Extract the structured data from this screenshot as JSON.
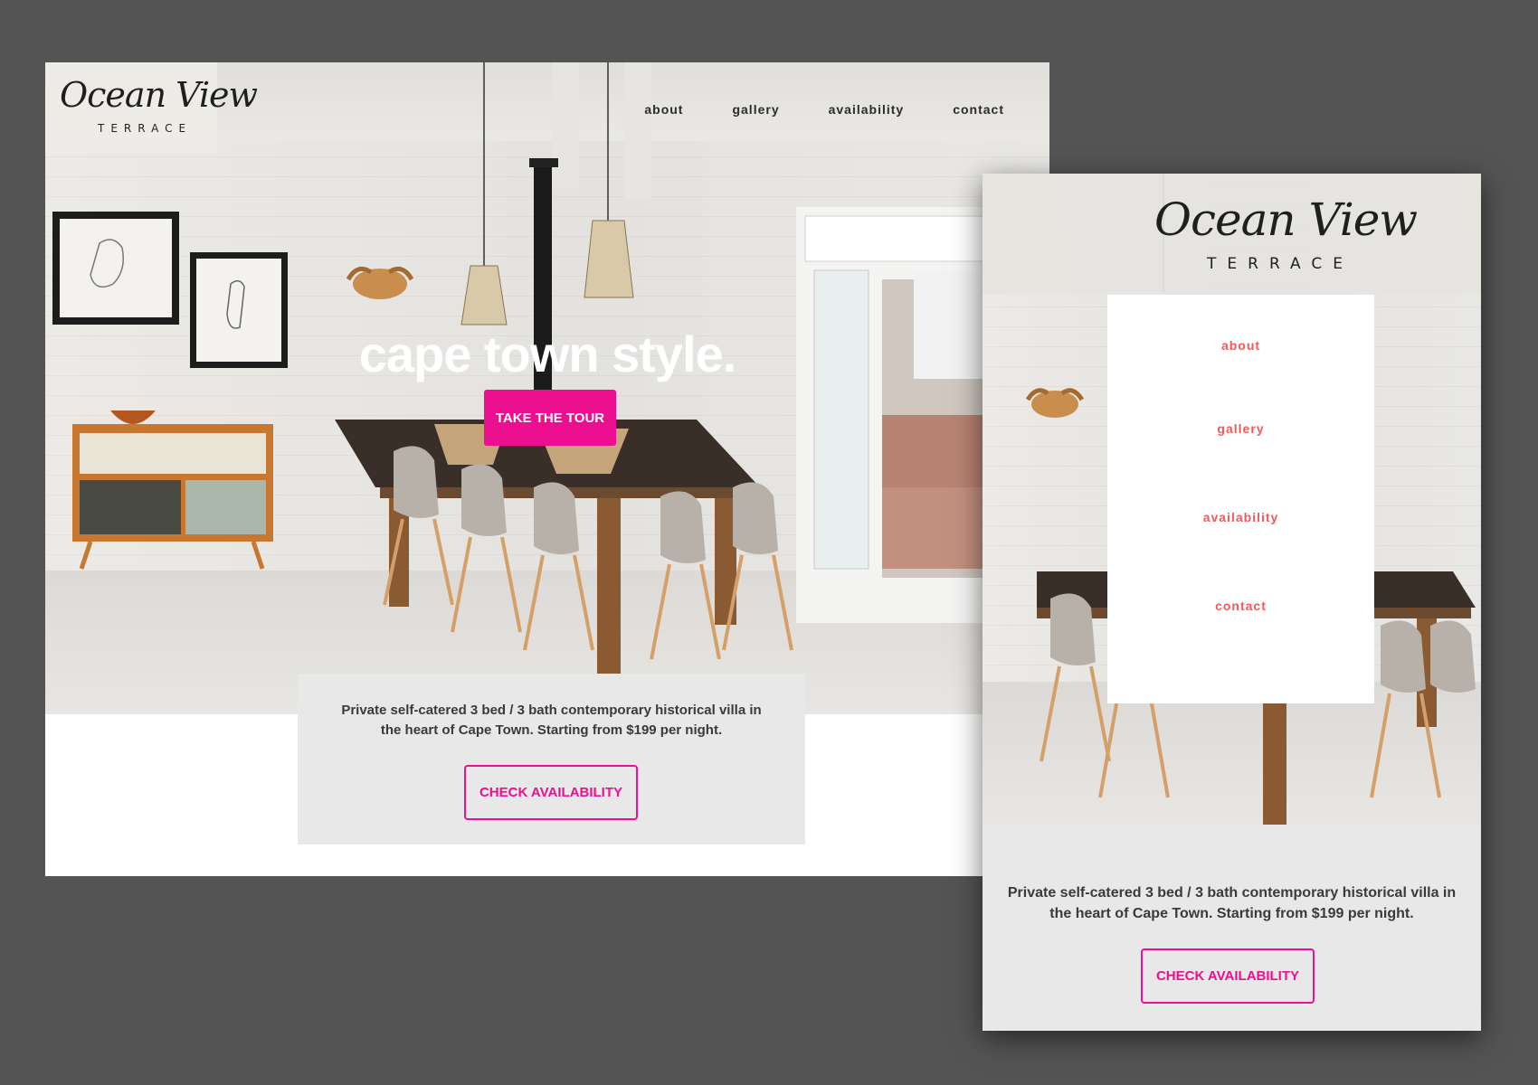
{
  "brand": {
    "name": "Ocean View",
    "subtitle": "TERRACE"
  },
  "nav": {
    "items": [
      "about",
      "gallery",
      "availability",
      "contact"
    ]
  },
  "hero": {
    "title": "cape town style.",
    "tour_button": "TAKE THE TOUR"
  },
  "info": {
    "text": "Private self-catered 3 bed / 3 bath contemporary historical villa in the heart of Cape Town. Starting from $199 per night.",
    "button": "CHECK AVAILABILITY"
  },
  "colors": {
    "accent": "#ec0f8f",
    "mobile_menu_text": "#f25a5a",
    "panel_bg": "#e8e8e8",
    "backdrop": "#545454"
  }
}
